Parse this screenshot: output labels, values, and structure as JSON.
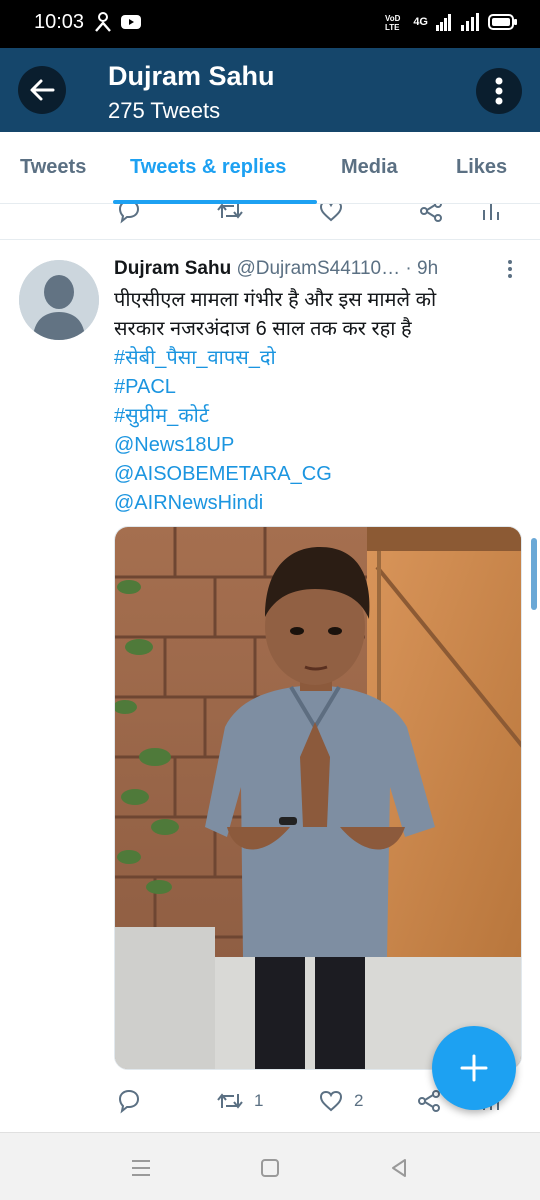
{
  "status_bar": {
    "time": "10:03",
    "network": "4G"
  },
  "header": {
    "title": "Dujram Sahu",
    "subtitle": "275 Tweets"
  },
  "tabs": [
    {
      "label": "Tweets",
      "active": false
    },
    {
      "label": "Tweets & replies",
      "active": true
    },
    {
      "label": "Media",
      "active": false
    },
    {
      "label": "Likes",
      "active": false
    }
  ],
  "tweet": {
    "author_name": "Dujram Sahu",
    "author_handle": "@DujramS44110…",
    "time": "· 9h",
    "text_lines": [
      "पीएसीएल मामला गंभीर है और इस मामले को",
      "सरकार नजरअंदाज 6 साल तक कर रहा है"
    ],
    "links": [
      "#सेबी_पैसा_वापस_दो",
      "#PACL",
      "#सुप्रीम_कोर्ट",
      "@News18UP",
      "@AISOBEMETARA_CG",
      "@AIRNewsHindi"
    ],
    "retweet_count": "1",
    "like_count": "2"
  },
  "colors": {
    "header_bg": "#15466b",
    "accent": "#1da1f2",
    "link": "#1b95e0",
    "muted": "#5b7083"
  },
  "icons": {
    "back": "arrow-left-icon",
    "more": "vertical-dots-icon",
    "reply": "speech-bubble-icon",
    "retweet": "retweet-icon",
    "like": "heart-icon",
    "share": "share-icon",
    "analytics": "bar-chart-icon",
    "compose": "plus-icon"
  }
}
